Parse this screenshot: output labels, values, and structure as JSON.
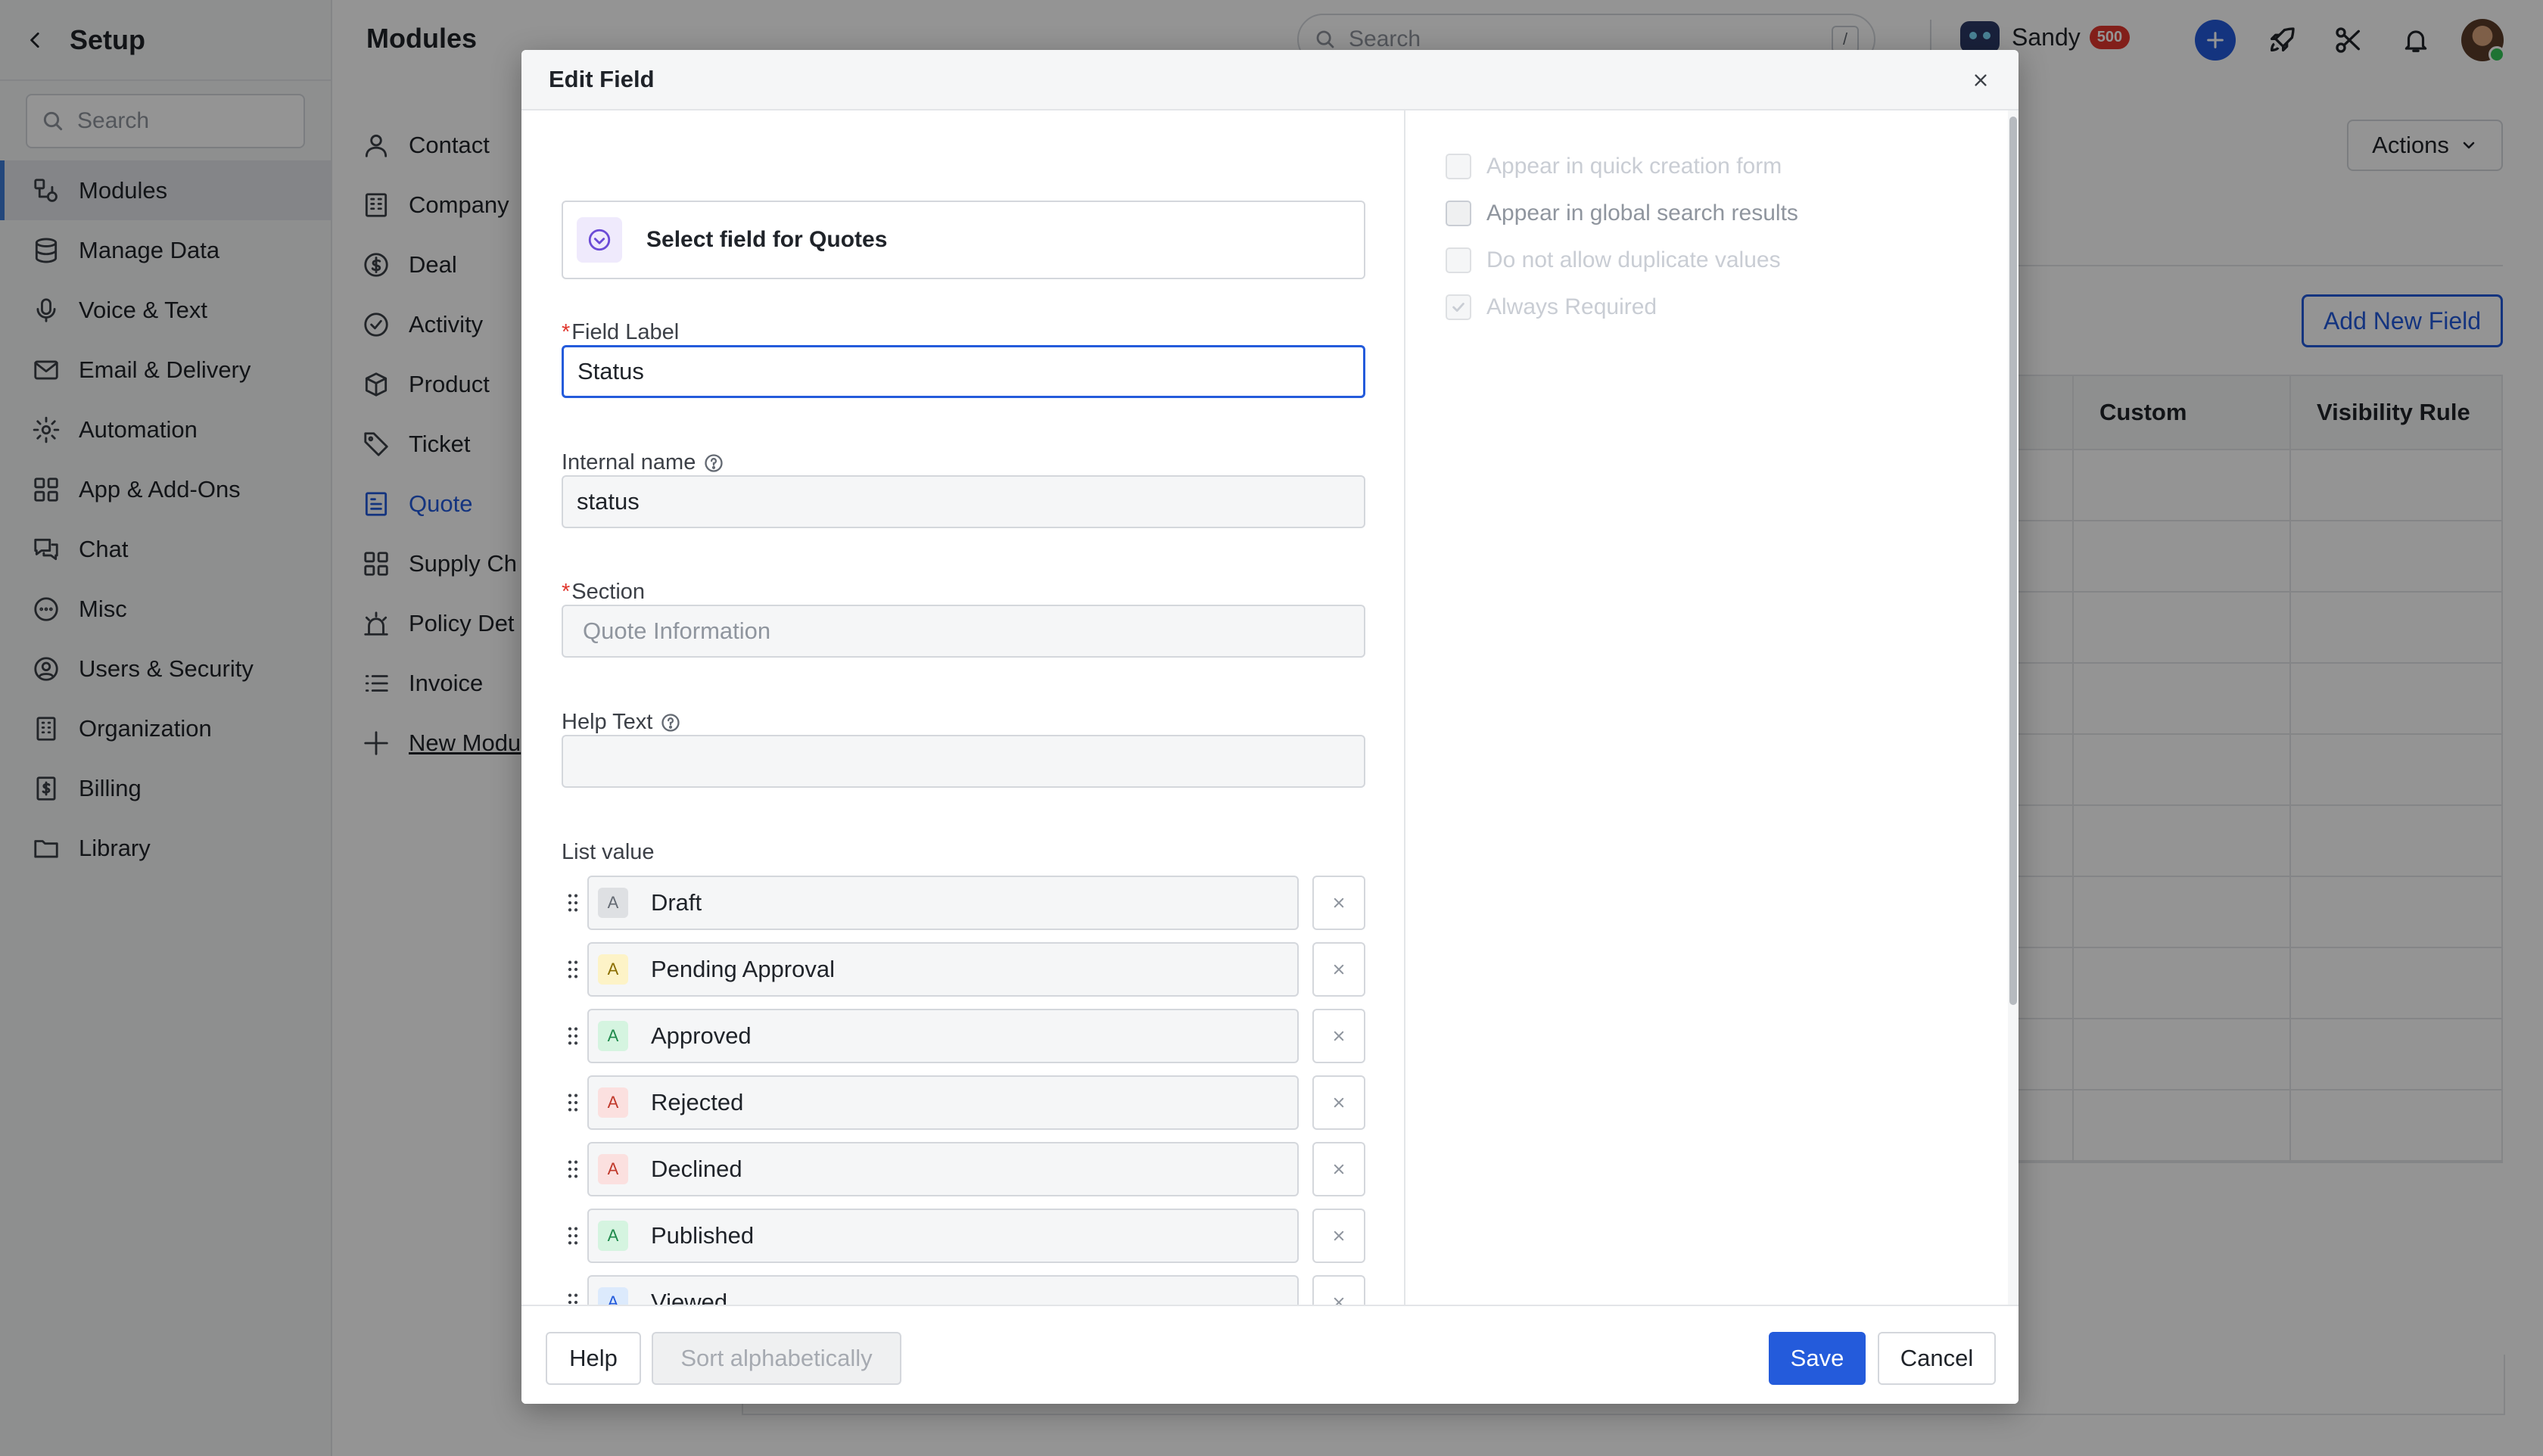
{
  "app": {
    "setup_title": "Setup",
    "sidebar_search_placeholder": "Search",
    "sidebar_items": [
      {
        "label": "Modules",
        "icon": "modules-icon",
        "active": true
      },
      {
        "label": "Manage Data",
        "icon": "database-icon"
      },
      {
        "label": "Voice & Text",
        "icon": "microphone-icon"
      },
      {
        "label": "Email & Delivery",
        "icon": "mail-icon"
      },
      {
        "label": "Automation",
        "icon": "automation-icon"
      },
      {
        "label": "App & Add-Ons",
        "icon": "apps-grid-icon"
      },
      {
        "label": "Chat",
        "icon": "chat-icon"
      },
      {
        "label": "Misc",
        "icon": "more-circle-icon"
      },
      {
        "label": "Users & Security",
        "icon": "user-circle-icon"
      },
      {
        "label": "Organization",
        "icon": "building-icon"
      },
      {
        "label": "Billing",
        "icon": "invoice-icon"
      },
      {
        "label": "Library",
        "icon": "folder-icon"
      }
    ],
    "modules_title": "Modules",
    "modules": [
      {
        "label": "Contact",
        "icon": "person-icon"
      },
      {
        "label": "Company",
        "icon": "company-icon"
      },
      {
        "label": "Deal",
        "icon": "dollar-icon"
      },
      {
        "label": "Activity",
        "icon": "check-circle-icon"
      },
      {
        "label": "Product",
        "icon": "box-icon"
      },
      {
        "label": "Ticket",
        "icon": "ticket-icon"
      },
      {
        "label": "Quote",
        "icon": "quote-icon",
        "active": true
      },
      {
        "label": "Supply Ch",
        "icon": "supply-chain-icon"
      },
      {
        "label": "Policy Det",
        "icon": "policy-icon"
      },
      {
        "label": "Invoice",
        "icon": "list-icon"
      },
      {
        "label": "New Modu",
        "icon": "plus-icon",
        "link": true
      }
    ],
    "topbar": {
      "search_placeholder": "Search",
      "search_shortcut": "/",
      "user_name": "Sandy",
      "user_badge": "500"
    },
    "actions_label": "Actions",
    "add_new_field_label": "Add New Field",
    "table_headers": [
      "Custom",
      "Visibility Rule"
    ]
  },
  "modal": {
    "title": "Edit Field",
    "field_type": "Select field for Quotes",
    "field_label": {
      "label": "Field Label",
      "value": "Status"
    },
    "internal_name": {
      "label": "Internal name",
      "value": "status"
    },
    "section": {
      "label": "Section",
      "placeholder": "Quote Information"
    },
    "help_text": {
      "label": "Help Text",
      "value": ""
    },
    "list_value_label": "List value",
    "list_values": [
      {
        "label": "Draft",
        "color": "#dee0e3",
        "text_color": "#646a73"
      },
      {
        "label": "Pending Approval",
        "color": "#fdf3c7",
        "text_color": "#8a6d00"
      },
      {
        "label": "Approved",
        "color": "#d5f4e0",
        "text_color": "#1f8a4c"
      },
      {
        "label": "Rejected",
        "color": "#fbe0df",
        "text_color": "#c0392b"
      },
      {
        "label": "Declined",
        "color": "#fbe0df",
        "text_color": "#c0392b"
      },
      {
        "label": "Published",
        "color": "#d5f4e0",
        "text_color": "#1f8a4c"
      },
      {
        "label": "Viewed",
        "color": "#dceafc",
        "text_color": "#245bdb"
      }
    ],
    "list_chip_letter": "A",
    "options": [
      {
        "label": "Appear in quick creation form",
        "checked": false,
        "enabled": false
      },
      {
        "label": "Appear in global search results",
        "checked": false,
        "enabled": true
      },
      {
        "label": "Do not allow duplicate values",
        "checked": false,
        "enabled": false
      },
      {
        "label": "Always Required",
        "checked": true,
        "enabled": false
      }
    ],
    "footer": {
      "help": "Help",
      "sort": "Sort alphabetically",
      "save": "Save",
      "cancel": "Cancel"
    },
    "colors": {
      "primary": "#245bdb",
      "required": "#e0362d"
    }
  }
}
